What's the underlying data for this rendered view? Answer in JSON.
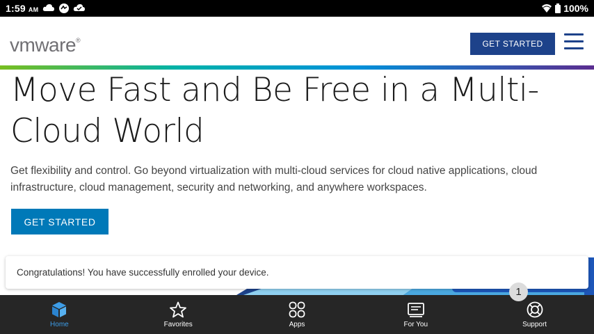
{
  "status_bar": {
    "time": "1:59",
    "ampm": "AM",
    "battery": "100%"
  },
  "header": {
    "logo": "vmware",
    "logo_mark": "®",
    "cta": "GET STARTED",
    "accent": "#1d428a"
  },
  "hero": {
    "title": "Move Fast and Be Free in a Multi-Cloud World",
    "description": "Get flexibility and control. Go beyond virtualization with multi-cloud services for cloud native applications, cloud infrastructure, cloud management, security and networking, and anywhere workspaces.",
    "cta": "GET STARTED",
    "cta_color": "#0079b8"
  },
  "toast": {
    "message": "Congratulations! You have successfully enrolled your device."
  },
  "bottom_nav": {
    "items": [
      {
        "label": "Home",
        "icon": "cube-icon",
        "active": true
      },
      {
        "label": "Favorites",
        "icon": "star-icon",
        "active": false
      },
      {
        "label": "Apps",
        "icon": "apps-grid-icon",
        "active": false
      },
      {
        "label": "For You",
        "icon": "feed-icon",
        "active": false
      },
      {
        "label": "Support",
        "icon": "lifebuoy-icon",
        "active": false
      }
    ],
    "support_badge": "1"
  }
}
